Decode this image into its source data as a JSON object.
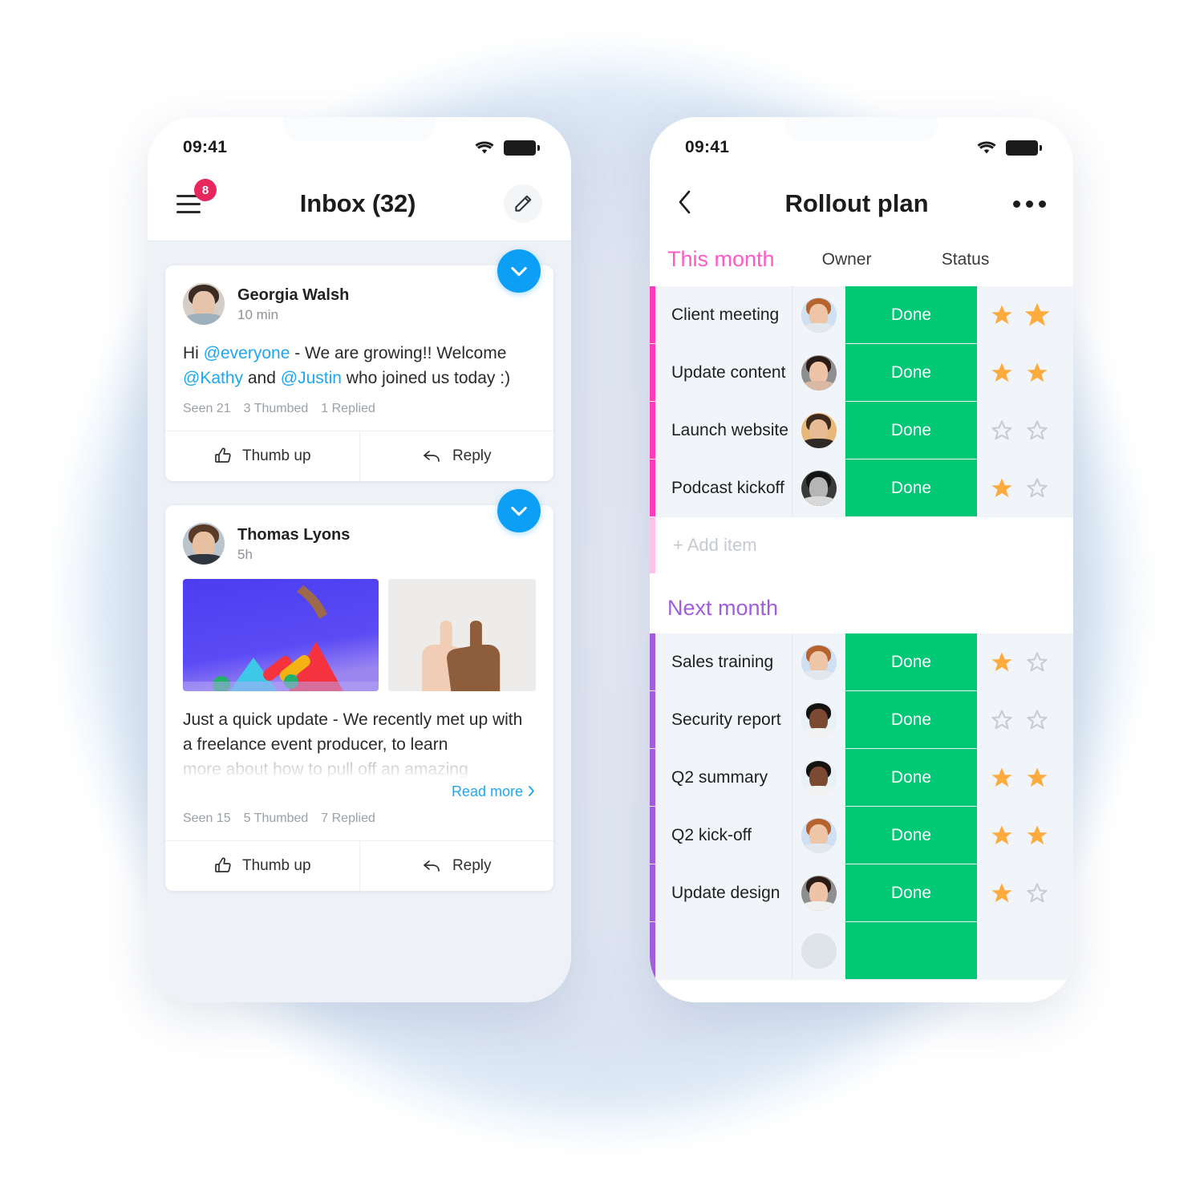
{
  "status_bar": {
    "time": "09:41",
    "wifi_icon": "wifi-icon",
    "battery_icon": "battery-icon"
  },
  "inbox_screen": {
    "menu_icon": "hamburger-menu-icon",
    "menu_badge": "8",
    "title": "Inbox (32)",
    "compose_icon": "pencil-edit-icon",
    "posts": [
      {
        "author": "Georgia Walsh",
        "time": "10 min",
        "check_icon": "check-circle-icon",
        "text_segments": [
          {
            "t": "Hi ",
            "type": "plain"
          },
          {
            "t": "@everyone",
            "type": "mention"
          },
          {
            "t": " - We are growing!! Welcome ",
            "type": "plain"
          },
          {
            "t": "@Kathy",
            "type": "mention"
          },
          {
            "t": " and ",
            "type": "plain"
          },
          {
            "t": "@Justin",
            "type": "mention"
          },
          {
            "t": " who joined us today :)",
            "type": "plain"
          }
        ],
        "stats": [
          "Seen 21",
          "3  Thumbed",
          "1 Replied"
        ],
        "actions": [
          {
            "label": "Thumb up",
            "icon": "thumbs-up-icon"
          },
          {
            "label": "Reply",
            "icon": "reply-arrow-icon"
          }
        ]
      },
      {
        "author": "Thomas Lyons",
        "time": "5h",
        "check_icon": "check-circle-icon",
        "media": [
          {
            "name": "shapes-photo"
          },
          {
            "name": "thumbs-up-hands-photo"
          }
        ],
        "text_visible": "Just a quick update - We recently met up with a freelance event producer, to learn",
        "text_faded": "more about how to pull off an amazing",
        "read_more": "Read more",
        "read_more_icon": "chevron-right-icon",
        "stats": [
          "Seen 15",
          "5  Thumbed",
          "7 Replied"
        ],
        "actions": [
          {
            "label": "Thumb up",
            "icon": "thumbs-up-icon"
          },
          {
            "label": "Reply",
            "icon": "reply-arrow-icon"
          }
        ]
      }
    ]
  },
  "plan_screen": {
    "back_icon": "back-chevron-icon",
    "title": "Rollout plan",
    "more_icon": "more-options-icon",
    "columns": {
      "owner": "Owner",
      "status": "Status"
    },
    "groups": [
      {
        "name": "This month",
        "color": "#ff5ac4",
        "accent": "#ff3bbb",
        "rows": [
          {
            "name": "Client meeting",
            "owner_avatar": "avatar-male-ginger",
            "status": "Done",
            "stars": [
              true,
              true
            ]
          },
          {
            "name": "Update content",
            "owner_avatar": "avatar-female-brunette",
            "status": "Done",
            "stars": [
              true,
              true
            ]
          },
          {
            "name": "Launch website",
            "owner_avatar": "avatar-male-beard",
            "status": "Done",
            "stars": [
              false,
              false
            ]
          },
          {
            "name": "Podcast kickoff",
            "owner_avatar": "avatar-female-sunglasses",
            "status": "Done",
            "stars": [
              true,
              false
            ]
          }
        ],
        "add_item": "+ Add item"
      },
      {
        "name": "Next month",
        "color": "#a25ddc",
        "accent": "#a25ddc",
        "rows": [
          {
            "name": "Sales training",
            "owner_avatar": "avatar-male-ginger",
            "status": "Done",
            "stars": [
              true,
              false
            ]
          },
          {
            "name": "Security report",
            "owner_avatar": "avatar-female-glasses",
            "status": "Done",
            "stars": [
              false,
              false
            ]
          },
          {
            "name": "Q2 summary",
            "owner_avatar": "avatar-female-curly",
            "status": "Done",
            "stars": [
              true,
              true
            ]
          },
          {
            "name": "Q2 kick-off",
            "owner_avatar": "avatar-male-ginger",
            "status": "Done",
            "stars": [
              true,
              true
            ]
          },
          {
            "name": "Update design",
            "owner_avatar": "avatar-female-dark",
            "status": "Done",
            "stars": [
              true,
              false
            ]
          }
        ]
      }
    ]
  },
  "colors": {
    "accent_blue": "#0d9ff5",
    "status_green": "#00c875",
    "group_pink": "#ff5ac4",
    "group_purple": "#a25ddc",
    "badge_red": "#e8275f",
    "star_gold": "#fdab3d"
  }
}
